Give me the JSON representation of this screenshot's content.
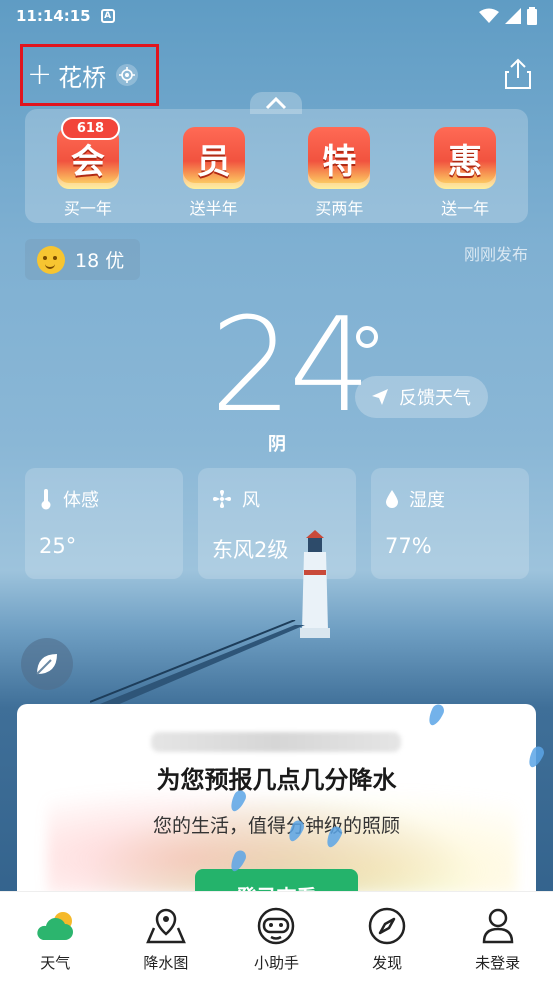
{
  "status_bar": {
    "time": "11:14:15",
    "badge": "A"
  },
  "header": {
    "plus": "+",
    "city": "花桥"
  },
  "promos": [
    {
      "char": "会",
      "label": "买一年",
      "badge": "618"
    },
    {
      "char": "员",
      "label": "送半年"
    },
    {
      "char": "特",
      "label": "买两年"
    },
    {
      "char": "惠",
      "label": "送一年"
    }
  ],
  "aqi": {
    "text": "18 优"
  },
  "publish_time": "刚刚发布",
  "weather": {
    "temperature": "24",
    "condition": "阴",
    "feedback": "反馈天气"
  },
  "stats": [
    {
      "title": "体感",
      "value": "25°"
    },
    {
      "title": "风",
      "value": "东风2级"
    },
    {
      "title": "湿度",
      "value": "77%"
    }
  ],
  "rain_card": {
    "title": "为您预报几点几分降水",
    "subtitle": "您的生活，值得分钟级的照顾",
    "button": "登录查看"
  },
  "tabs": [
    {
      "label": "天气",
      "icon": "weather-icon"
    },
    {
      "label": "降水图",
      "icon": "map-pin-icon"
    },
    {
      "label": "小助手",
      "icon": "robot-icon"
    },
    {
      "label": "发现",
      "icon": "compass-icon"
    },
    {
      "label": "未登录",
      "icon": "user-icon"
    }
  ],
  "colors": {
    "accent_green": "#24b36b",
    "highlight_red": "#e0141e"
  }
}
